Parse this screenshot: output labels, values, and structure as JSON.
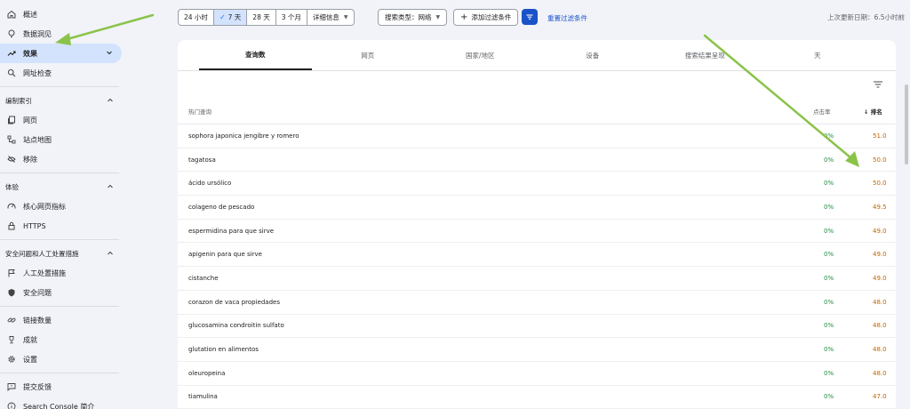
{
  "sidebar": {
    "items_top": [
      {
        "label": "概述",
        "icon": "home-icon"
      },
      {
        "label": "数据洞见",
        "icon": "lightbulb-icon"
      },
      {
        "label": "效果",
        "icon": "trending-up-icon",
        "active": true
      },
      {
        "label": "网址检查",
        "icon": "search-icon"
      }
    ],
    "sections": [
      {
        "title": "编制索引",
        "items": [
          {
            "label": "网页",
            "icon": "pages-icon"
          },
          {
            "label": "站点地图",
            "icon": "sitemap-icon"
          },
          {
            "label": "移除",
            "icon": "eye-off-icon"
          }
        ]
      },
      {
        "title": "体验",
        "items": [
          {
            "label": "核心网页指标",
            "icon": "speed-icon"
          },
          {
            "label": "HTTPS",
            "icon": "lock-icon"
          }
        ]
      },
      {
        "title": "安全问题和人工处置措施",
        "items": [
          {
            "label": "人工处置措施",
            "icon": "flag-icon"
          },
          {
            "label": "安全问题",
            "icon": "shield-icon"
          }
        ]
      }
    ],
    "items_bottom": [
      {
        "label": "链接数量",
        "icon": "link-icon"
      },
      {
        "label": "成就",
        "icon": "trophy-icon"
      },
      {
        "label": "设置",
        "icon": "gear-icon"
      }
    ],
    "items_footer": [
      {
        "label": "提交反馈",
        "icon": "feedback-icon"
      },
      {
        "label": "Search Console 简介",
        "icon": "info-icon"
      }
    ]
  },
  "topbar": {
    "ranges": [
      "24 小时",
      "7 天",
      "28 天",
      "3 个月",
      "详细信息"
    ],
    "selected_range": "7 天",
    "search_type": "搜索类型：网络",
    "add_filter": "添加过滤条件",
    "reset": "重置过滤条件",
    "updated": "上次更新日期：6.5小时前"
  },
  "tabs": [
    "查询数",
    "网页",
    "国家/地区",
    "设备",
    "搜索结果呈现",
    "天"
  ],
  "selected_tab": "查询数",
  "table": {
    "headers": {
      "query": "热门查询",
      "ctr": "点击率",
      "rank": "排名"
    },
    "rows": [
      {
        "query": "sophora japonica jengibre y romero",
        "ctr": "0%",
        "rank": "51.0"
      },
      {
        "query": "tagatosa",
        "ctr": "0%",
        "rank": "50.0"
      },
      {
        "query": "ácido ursólico",
        "ctr": "0%",
        "rank": "50.0"
      },
      {
        "query": "colageno de pescado",
        "ctr": "0%",
        "rank": "49.5"
      },
      {
        "query": "espermidina para que sirve",
        "ctr": "0%",
        "rank": "49.0"
      },
      {
        "query": "apigenin para que sirve",
        "ctr": "0%",
        "rank": "49.0"
      },
      {
        "query": "cistanche",
        "ctr": "0%",
        "rank": "49.0"
      },
      {
        "query": "corazon de vaca propiedades",
        "ctr": "0%",
        "rank": "48.0"
      },
      {
        "query": "glucosamina condroitin sulfato",
        "ctr": "0%",
        "rank": "48.0"
      },
      {
        "query": "glutation en alimentos",
        "ctr": "0%",
        "rank": "48.0"
      },
      {
        "query": "oleuropeina",
        "ctr": "0%",
        "rank": "48.0"
      },
      {
        "query": "tiamulina",
        "ctr": "0%",
        "rank": "47.0"
      }
    ]
  },
  "colors": {
    "accent": "#1a53c8",
    "ctr": "#1e8e3e",
    "rank": "#c26401",
    "arrow": "#8bc34a"
  }
}
